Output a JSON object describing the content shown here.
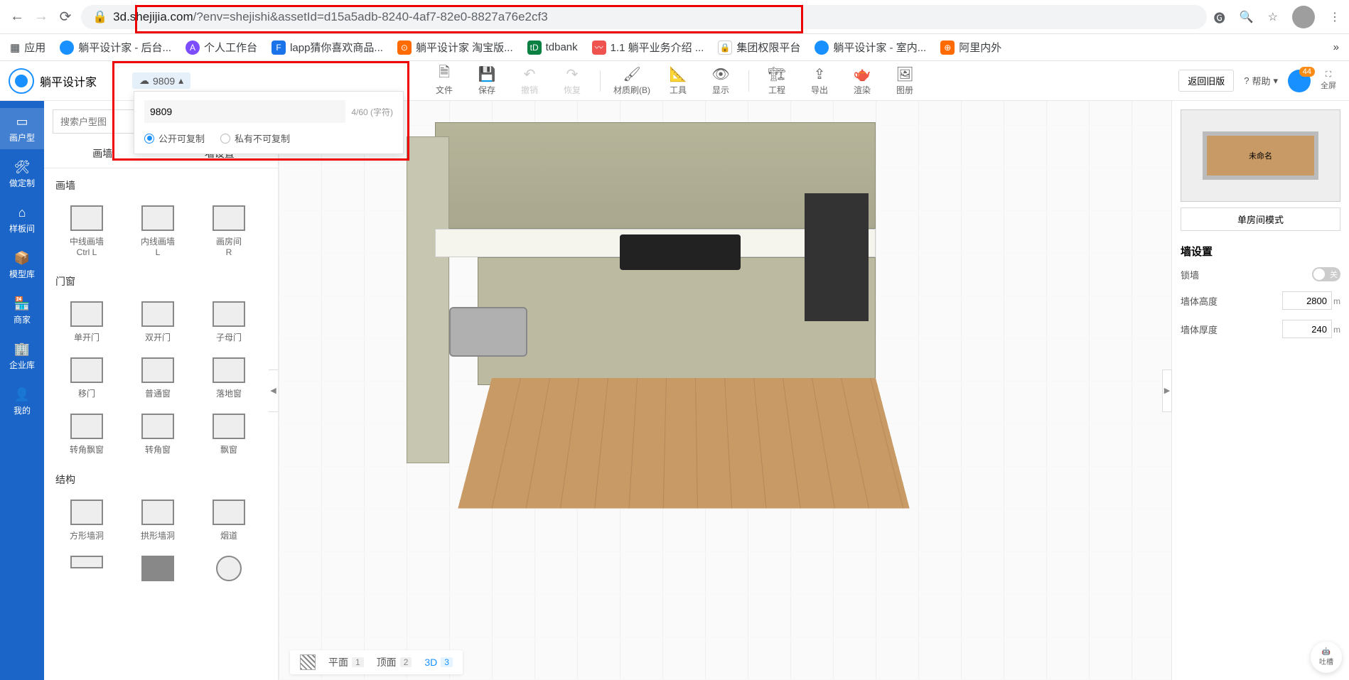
{
  "browser": {
    "url_domain": "3d.shejijia.com",
    "url_path": "/?env=shejishi&assetId=d15a5adb-8240-4af7-82e0-8827a76e2cf3"
  },
  "bookmarks": {
    "apps": "应用",
    "items": [
      "躺平设计家 - 后台...",
      "个人工作台",
      "lapp猜你喜欢商品...",
      "躺平设计家 淘宝版...",
      "tdbank",
      "1.1 躺平业务介绍 ...",
      "集团权限平台",
      "躺平设计家 - 室内...",
      "阿里内外"
    ]
  },
  "app": {
    "logo_text": "躺平设计家",
    "project_name": "9809",
    "toolbar": [
      {
        "label": "文件"
      },
      {
        "label": "保存"
      },
      {
        "label": "撤销"
      },
      {
        "label": "恢复"
      },
      {
        "label": "材质刷(B)"
      },
      {
        "label": "工具"
      },
      {
        "label": "显示"
      },
      {
        "label": "工程"
      },
      {
        "label": "导出"
      },
      {
        "label": "渲染"
      },
      {
        "label": "图册"
      }
    ],
    "return_old": "返回旧版",
    "help": "帮助",
    "avatar_badge": "44",
    "fullscreen": "全屏"
  },
  "rail": [
    "画户型",
    "做定制",
    "样板间",
    "模型库",
    "商家",
    "企业库",
    "我的"
  ],
  "palette": {
    "search_placeholder": "搜索户型图",
    "tabs": [
      "画墙",
      "墙设置"
    ],
    "sections": [
      {
        "title": "画墙",
        "items": [
          {
            "label": "中线画墙\nCtrl L"
          },
          {
            "label": "内线画墙\nL"
          },
          {
            "label": "画房间\nR"
          }
        ]
      },
      {
        "title": "门窗",
        "items": [
          {
            "label": "单开门"
          },
          {
            "label": "双开门"
          },
          {
            "label": "子母门"
          },
          {
            "label": "移门"
          },
          {
            "label": "普通窗"
          },
          {
            "label": "落地窗"
          },
          {
            "label": "转角飘窗"
          },
          {
            "label": "转角窗"
          },
          {
            "label": "飘窗"
          }
        ]
      },
      {
        "title": "结构",
        "items": [
          {
            "label": "方形墙洞"
          },
          {
            "label": "拱形墙洞"
          },
          {
            "label": "烟道"
          }
        ]
      }
    ]
  },
  "popup": {
    "name_value": "9809",
    "char_count": "4/60 (字符)",
    "opt_public": "公开可复制",
    "opt_private": "私有不可复制"
  },
  "view_switch": {
    "plan": "平面",
    "plan_n": "1",
    "top": "顶面",
    "top_n": "2",
    "threeD": "3D",
    "threeD_n": "3"
  },
  "minimap": {
    "room_label": "未命名",
    "mode_btn": "单房间模式"
  },
  "props": {
    "title": "墙设置",
    "lock_wall": "锁墙",
    "lock_state": "关",
    "wall_height": "墙体高度",
    "wall_height_val": "2800",
    "unit_h": "m",
    "wall_thick": "墙体厚度",
    "wall_thick_val": "240",
    "unit_t": "m"
  },
  "feedback": "吐槽"
}
